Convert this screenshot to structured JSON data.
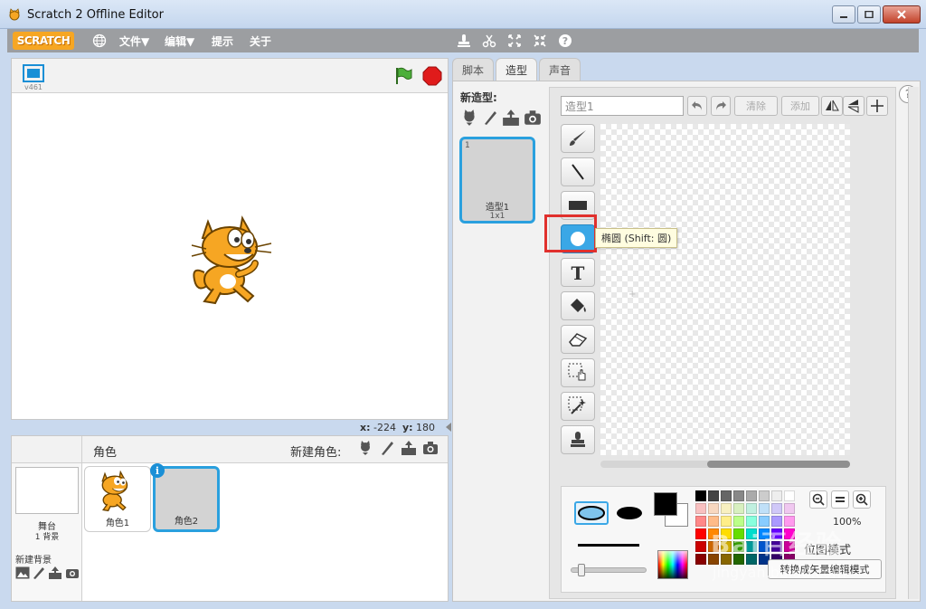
{
  "window": {
    "title": "Scratch 2 Offline Editor"
  },
  "menubar": {
    "logo": "SCRATCH",
    "items": [
      "文件▼",
      "编辑▼",
      "提示",
      "关于"
    ]
  },
  "stage": {
    "version": "v461",
    "coords": {
      "x_label": "x:",
      "x": "-224",
      "y_label": "y:",
      "y": "180"
    }
  },
  "sprites": {
    "label": "角色",
    "new_label": "新建角色:",
    "stage_name": "舞台",
    "stage_backdrops": "1 背景",
    "new_backdrop_label": "新建背景",
    "items": [
      {
        "name": "角色1"
      },
      {
        "name": "角色2",
        "selected": true
      }
    ]
  },
  "tabs": [
    {
      "label": "脚本"
    },
    {
      "label": "造型",
      "active": true
    },
    {
      "label": "声音"
    }
  ],
  "costumes": {
    "new_label": "新造型:",
    "items": [
      {
        "index": "1",
        "name": "造型1",
        "size": "1x1"
      }
    ]
  },
  "editor": {
    "costume_name": "造型1",
    "clear_label": "清除",
    "add_label": "添加",
    "tooltip": "椭圆 (Shift: 圆)",
    "zoom": "100%",
    "mode_label": "位图模式",
    "convert_label": "转换成矢量编辑模式",
    "active_tool": "ellipse-tool"
  },
  "watermark": {
    "main": "Bai百经验",
    "sub": "jingyan.baidu.com"
  }
}
